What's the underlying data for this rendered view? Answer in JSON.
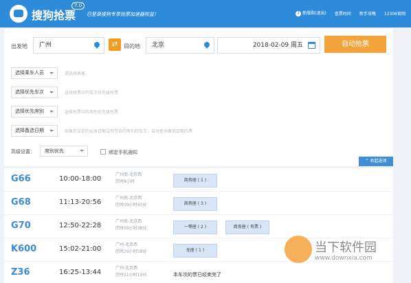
{
  "app": {
    "brand": "搜狗抢票",
    "version": "7.0",
    "slogan": "已登录搜狗专享抢票加速器权益！",
    "top_links": [
      "新版购(退出)",
      "查票时间",
      "新手攻略",
      "12306官网"
    ]
  },
  "search": {
    "from_label": "出发地",
    "from_value": "广州",
    "to_label": "目的地",
    "to_value": "北京",
    "date_value": "2018-02-09  周五",
    "auto_button": "自动抢票"
  },
  "filters": [
    {
      "label": "选择乘车人员",
      "hint": "请选择乘客"
    },
    {
      "label": "选择优先车次",
      "hint": "选择抢票中的车次优先级抢票"
    },
    {
      "label": "选择优先席别",
      "hint": "选择抢票中的席别优先级抢票"
    },
    {
      "label": "选择备选日期",
      "hint": "如果您设定的出发日期没有符合的席别和车次，自动查询备选日期的票"
    }
  ],
  "advanced": {
    "label": "高级设置：",
    "pref_value": "席别优先",
    "phone_notify": "绑定手机通知",
    "collapse": "收起选项"
  },
  "trains": [
    {
      "code": "G66",
      "time": "10:00-18:00",
      "route": "广州南-北京西",
      "duration": "历时8小时",
      "seats": [
        "商务座 ( 1 )"
      ],
      "note": ""
    },
    {
      "code": "G68",
      "time": "11:13-20:56",
      "route": "广州南-北京西",
      "duration": "历时09小时43分",
      "seats": [
        "商务座 ( 3 )"
      ],
      "note": ""
    },
    {
      "code": "G70",
      "time": "12:50-22:28",
      "route": "广州南-北京西",
      "duration": "历时09小时38分",
      "seats": [
        "一等座 ( 2 )",
        "商务座 ( 有票 )"
      ],
      "note": ""
    },
    {
      "code": "K600",
      "time": "15:02-21:00",
      "route": "广州-北京西",
      "duration": "历时29小时58分",
      "seats": [
        "无座 ( 1 )"
      ],
      "note": ""
    },
    {
      "code": "Z36",
      "time": "16:25-13:44",
      "route": "广州-北京西",
      "duration": "历时21小时19分",
      "seats": [],
      "note": "本车次的票已经卖完了"
    }
  ],
  "watermark": {
    "text": "当下软件园",
    "url": "www.downxia.com"
  }
}
